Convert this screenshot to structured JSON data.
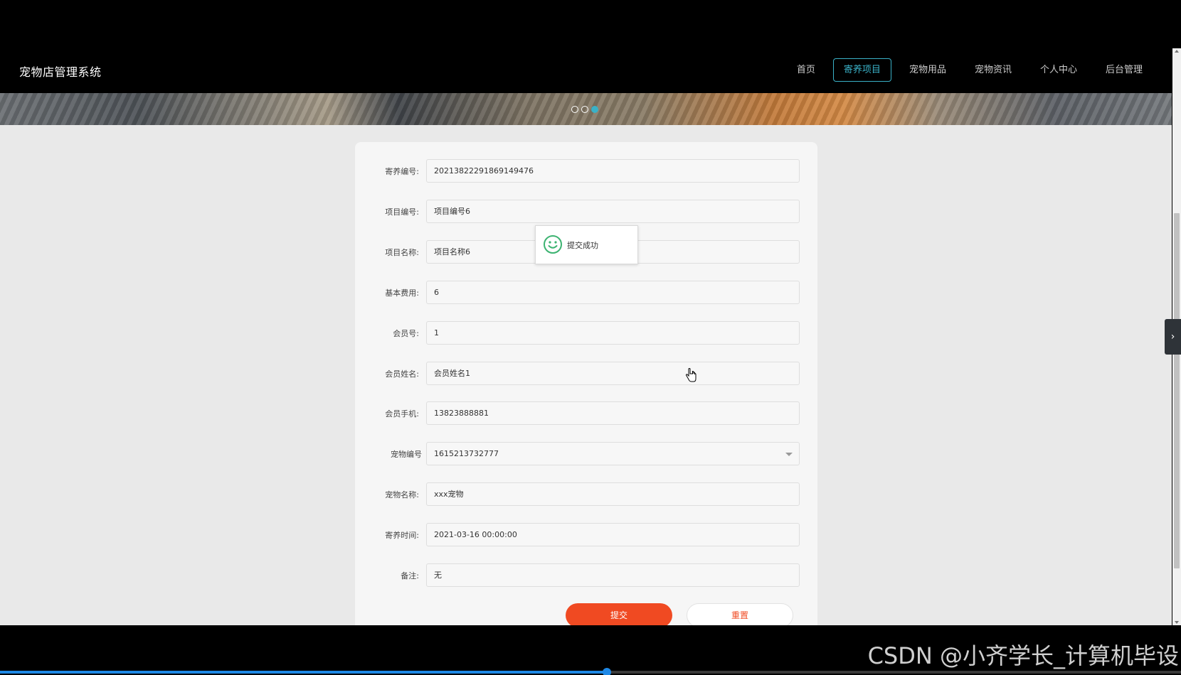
{
  "header": {
    "site_title": "宠物店管理系统",
    "nav": [
      {
        "label": "首页",
        "active": false
      },
      {
        "label": "寄养项目",
        "active": true
      },
      {
        "label": "宠物用品",
        "active": false
      },
      {
        "label": "宠物资讯",
        "active": false
      },
      {
        "label": "个人中心",
        "active": false
      },
      {
        "label": "后台管理",
        "active": false
      }
    ]
  },
  "banner": {
    "dots": 3,
    "active_dot": 3
  },
  "form": {
    "fields": [
      {
        "label": "寄养编号:",
        "value": "20213822291869149476"
      },
      {
        "label": "项目编号:",
        "value": "项目编号6"
      },
      {
        "label": "项目名称:",
        "value": "项目名称6"
      },
      {
        "label": "基本费用:",
        "value": "6"
      },
      {
        "label": "会员号:",
        "value": "1"
      },
      {
        "label": "会员姓名:",
        "value": "会员姓名1"
      },
      {
        "label": "会员手机:",
        "value": "13823888881"
      },
      {
        "label": "宠物编号",
        "value": "1615213732777",
        "type": "select"
      },
      {
        "label": "宠物名称:",
        "value": "xxx宠物"
      },
      {
        "label": "寄养时间:",
        "value": "2021-03-16 00:00:00"
      },
      {
        "label": "备注:",
        "value": "无"
      }
    ],
    "submit_label": "提交",
    "reset_label": "重置"
  },
  "toast": {
    "message": "提交成功",
    "icon": "smile-icon"
  },
  "watermark": "CSDN @小齐学长_计算机毕设",
  "video_progress": 0.514,
  "colors": {
    "accent": "#3ab1c7",
    "submit": "#f04a22",
    "progress": "#1e88e5"
  }
}
